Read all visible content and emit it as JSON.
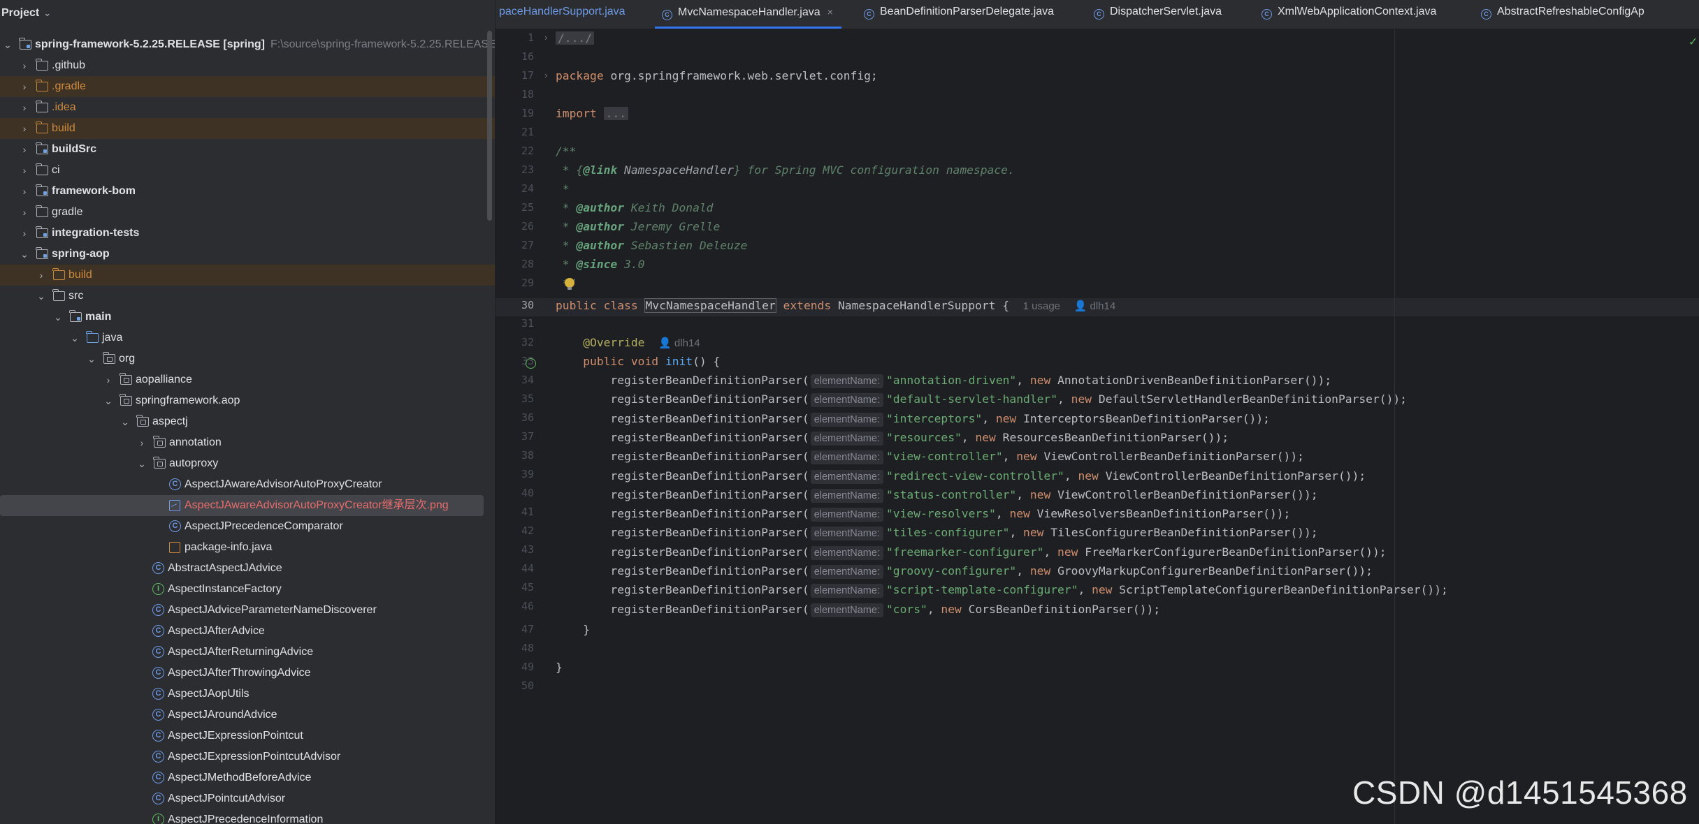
{
  "project_panel": {
    "title": "Project",
    "root": {
      "name": "spring-framework-5.2.25.RELEASE [spring]",
      "path": "F:\\source\\spring-framework-5.2.25.RELEASE"
    },
    "items": [
      {
        "label": ".github"
      },
      {
        "label": ".gradle"
      },
      {
        "label": ".idea"
      },
      {
        "label": "build"
      },
      {
        "label": "buildSrc"
      },
      {
        "label": "ci"
      },
      {
        "label": "framework-bom"
      },
      {
        "label": "gradle"
      },
      {
        "label": "integration-tests"
      },
      {
        "label": "spring-aop"
      },
      {
        "label": "build"
      },
      {
        "label": "src"
      },
      {
        "label": "main"
      },
      {
        "label": "java"
      },
      {
        "label": "org"
      },
      {
        "label": "aopalliance"
      },
      {
        "label": "springframework.aop"
      },
      {
        "label": "aspectj"
      },
      {
        "label": "annotation"
      },
      {
        "label": "autoproxy"
      },
      {
        "label": "AspectJAwareAdvisorAutoProxyCreator"
      },
      {
        "label": "AspectJAwareAdvisorAutoProxyCreator继承层次.png"
      },
      {
        "label": "AspectJPrecedenceComparator"
      },
      {
        "label": "package-info.java"
      },
      {
        "label": "AbstractAspectJAdvice"
      },
      {
        "label": "AspectInstanceFactory"
      },
      {
        "label": "AspectJAdviceParameterNameDiscoverer"
      },
      {
        "label": "AspectJAfterAdvice"
      },
      {
        "label": "AspectJAfterReturningAdvice"
      },
      {
        "label": "AspectJAfterThrowingAdvice"
      },
      {
        "label": "AspectJAopUtils"
      },
      {
        "label": "AspectJAroundAdvice"
      },
      {
        "label": "AspectJExpressionPointcut"
      },
      {
        "label": "AspectJExpressionPointcutAdvisor"
      },
      {
        "label": "AspectJMethodBeforeAdvice"
      },
      {
        "label": "AspectJPointcutAdvisor"
      },
      {
        "label": "AspectJPrecedenceInformation"
      }
    ]
  },
  "tabs": [
    {
      "label": "paceHandlerSupport.java"
    },
    {
      "label": "MvcNamespaceHandler.java",
      "close": "×"
    },
    {
      "label": "BeanDefinitionParserDelegate.java"
    },
    {
      "label": "DispatcherServlet.java"
    },
    {
      "label": "XmlWebApplicationContext.java"
    },
    {
      "label": "AbstractRefreshableConfigAp"
    }
  ],
  "editor": {
    "line_numbers": [
      "1",
      "16",
      "17",
      "18",
      "19",
      "21",
      "22",
      "23",
      "24",
      "25",
      "26",
      "27",
      "28",
      "29",
      "30",
      "31",
      "32",
      "33",
      "34",
      "35",
      "36",
      "37",
      "38",
      "39",
      "40",
      "41",
      "42",
      "43",
      "44",
      "45",
      "46",
      "47",
      "48",
      "49",
      "50"
    ],
    "folded_header": "/.../",
    "package_kw": "package",
    "package_name": "org.springframework.web.servlet.config;",
    "import_kw": "import",
    "import_folded": "...",
    "doc_open": "/**",
    "doc_link_prefix": " * {",
    "doc_link_tag": "@link",
    "doc_link_ref": " NamespaceHandler",
    "doc_link_suffix": "} for Spring MVC configuration namespace.",
    "doc_star": " *",
    "authors": [
      {
        "tag": "@author",
        "name": " Keith Donald"
      },
      {
        "tag": "@author",
        "name": " Jeremy Grelle"
      },
      {
        "tag": "@author",
        "name": " Sebastien Deleuze"
      }
    ],
    "since_tag": "@since",
    "since_val": " 3.0",
    "doc_close": " */",
    "class_decl": {
      "public": "public",
      "class": "class",
      "name": "MvcNamespaceHandler",
      "extends": "extends",
      "parent": "NamespaceHandlerSupport {"
    },
    "usages": "1 usage",
    "author_hint": "dlh14",
    "override": "@Override",
    "method": {
      "public": "public",
      "void": "void",
      "name": "init",
      "rest": "() {"
    },
    "call_name": "registerBeanDefinitionParser(",
    "param_hint": "elementName:",
    "registrations": [
      {
        "key": "\"annotation-driven\"",
        "parser": "AnnotationDrivenBeanDefinitionParser());"
      },
      {
        "key": "\"default-servlet-handler\"",
        "parser": "DefaultServletHandlerBeanDefinitionParser());"
      },
      {
        "key": "\"interceptors\"",
        "parser": "InterceptorsBeanDefinitionParser());"
      },
      {
        "key": "\"resources\"",
        "parser": "ResourcesBeanDefinitionParser());"
      },
      {
        "key": "\"view-controller\"",
        "parser": "ViewControllerBeanDefinitionParser());"
      },
      {
        "key": "\"redirect-view-controller\"",
        "parser": "ViewControllerBeanDefinitionParser());"
      },
      {
        "key": "\"status-controller\"",
        "parser": "ViewControllerBeanDefinitionParser());"
      },
      {
        "key": "\"view-resolvers\"",
        "parser": "ViewResolversBeanDefinitionParser());"
      },
      {
        "key": "\"tiles-configurer\"",
        "parser": "TilesConfigurerBeanDefinitionParser());"
      },
      {
        "key": "\"freemarker-configurer\"",
        "parser": "FreeMarkerConfigurerBeanDefinitionParser());"
      },
      {
        "key": "\"groovy-configurer\"",
        "parser": "GroovyMarkupConfigurerBeanDefinitionParser());"
      },
      {
        "key": "\"script-template-configurer\"",
        "parser": "ScriptTemplateConfigurerBeanDefinitionParser());"
      },
      {
        "key": "\"cors\"",
        "parser": "CorsBeanDefinitionParser());"
      }
    ],
    "comma_new": ", ",
    "new_kw": "new",
    "close_method": "}",
    "close_class": "}"
  },
  "watermark": "CSDN @d1451545368",
  "colors": {
    "accent": "#3574f0",
    "keyword": "#cf8e6d",
    "string": "#6aab73",
    "function": "#56a8f5"
  }
}
